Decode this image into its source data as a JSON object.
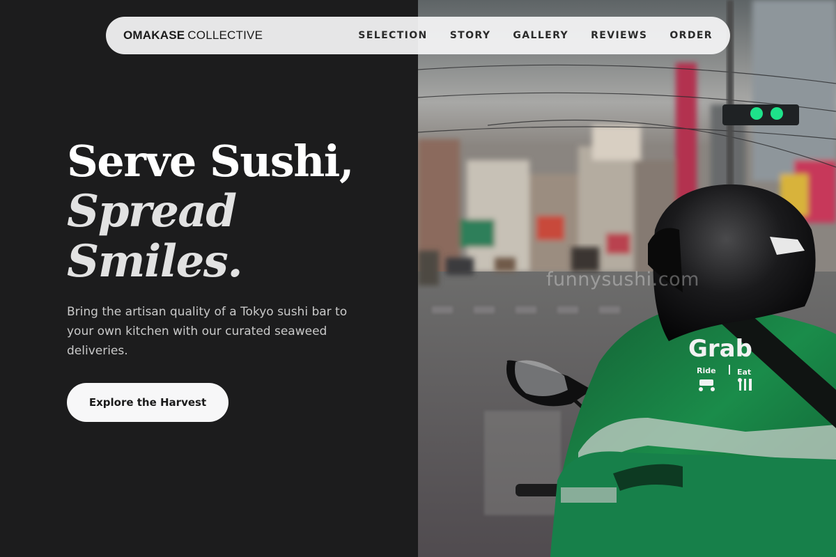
{
  "brand": {
    "bold": "OMAKASE",
    "light": "COLLECTIVE"
  },
  "nav": {
    "items": [
      {
        "label": "SELECTION"
      },
      {
        "label": "STORY"
      },
      {
        "label": "GALLERY"
      },
      {
        "label": "REVIEWS"
      },
      {
        "label": "ORDER"
      }
    ]
  },
  "hero": {
    "headline_line1": "Serve Sushi,",
    "headline_line2": "Spread",
    "headline_line3": "Smiles.",
    "subtitle": "Bring the artisan quality of a Tokyo sushi bar to your own kitchen with our curated seaweed deliveries.",
    "cta_label": "Explore the Harvest"
  },
  "photo": {
    "watermark": "funnysushi.com",
    "jacket_brand": "Grab",
    "jacket_ride": "Ride",
    "jacket_eat": "Eat"
  },
  "colors": {
    "background": "#1c1c1d",
    "nav_bg": "#f5f5f6",
    "cta_bg": "#f7f7f8",
    "jacket_green": "#1b8a4a",
    "traffic_light": "#1ee28a"
  }
}
